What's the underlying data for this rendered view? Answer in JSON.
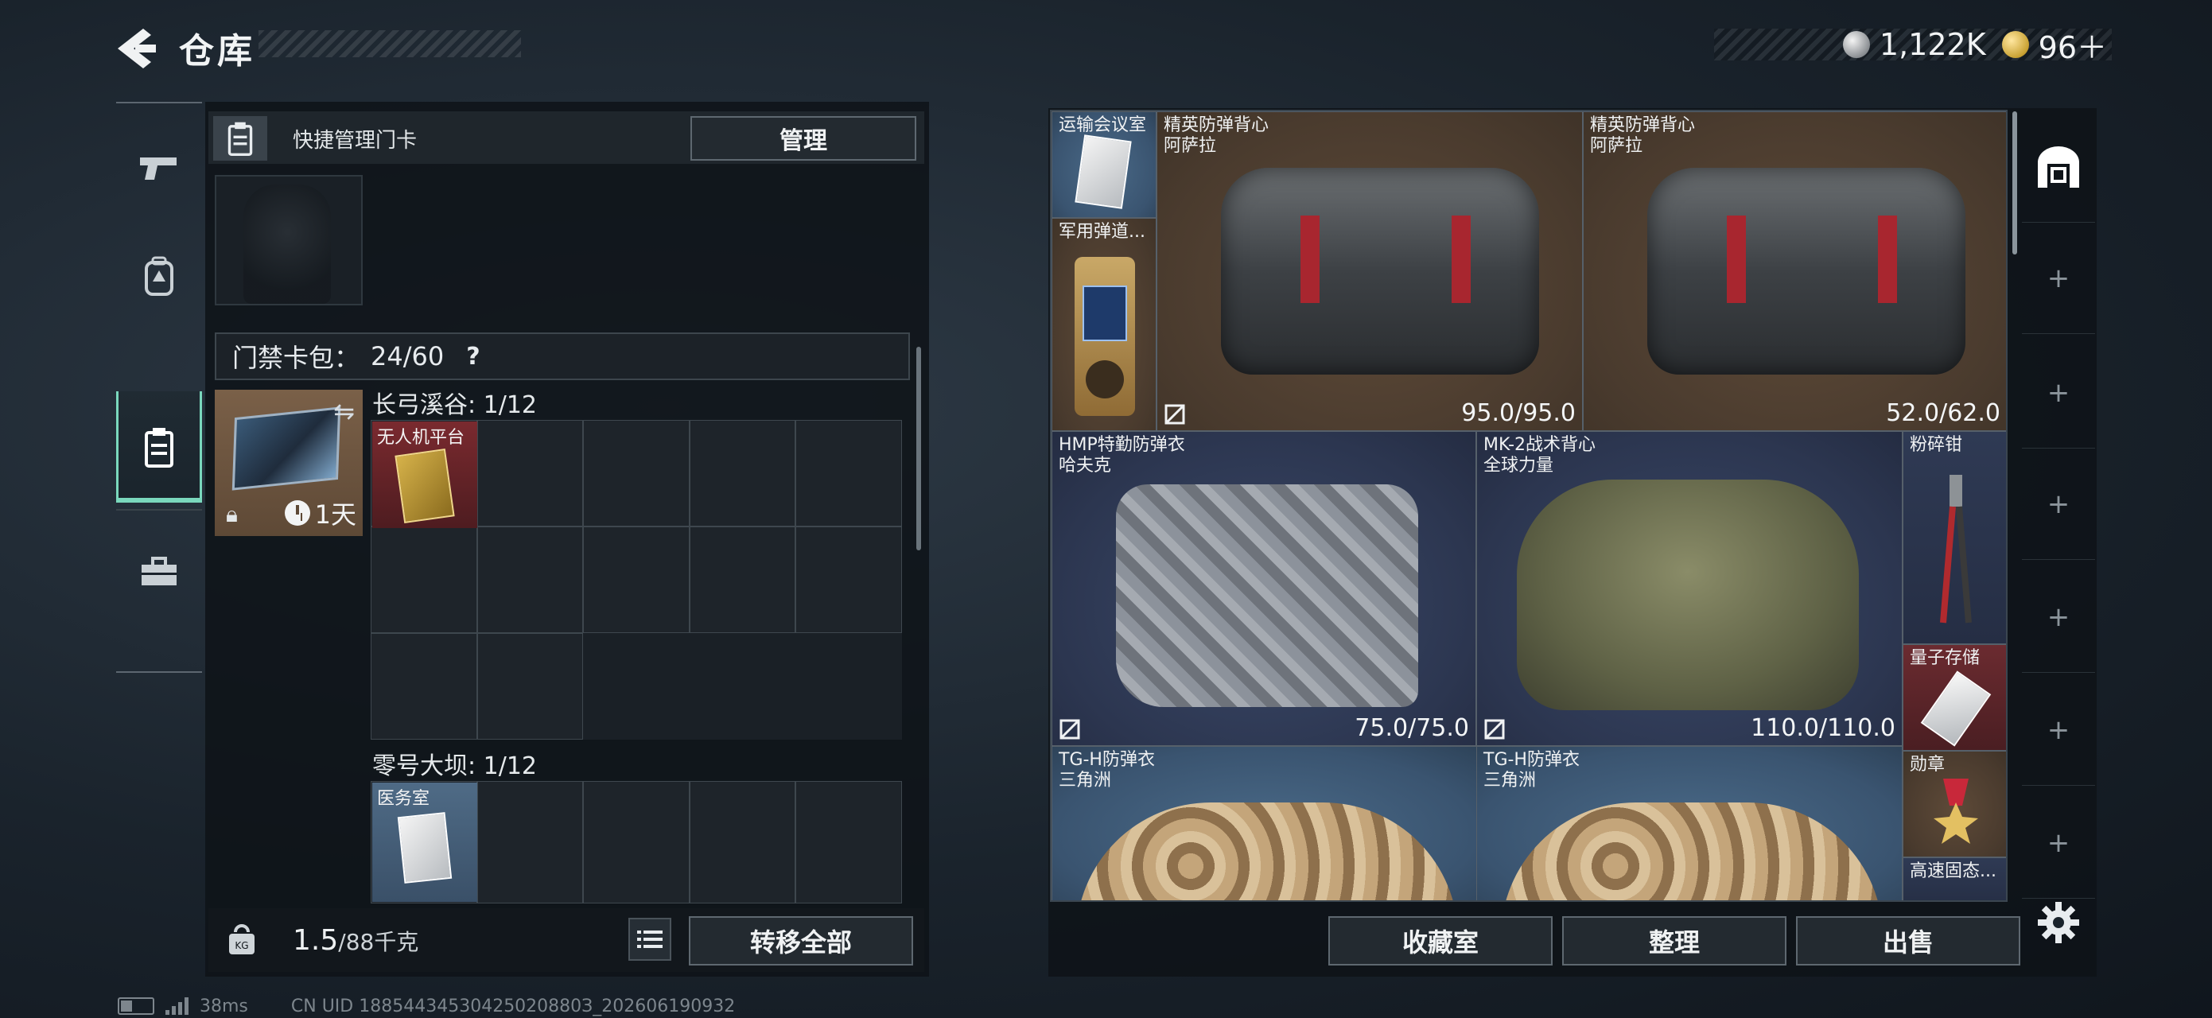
{
  "header": {
    "title": "仓库"
  },
  "currency": {
    "silver": "1,122K",
    "gold": "96＋"
  },
  "left_nav": {
    "items": [
      "weapons",
      "equipment",
      "keycards",
      "toolbox"
    ],
    "active": "keycards"
  },
  "quick_manage": {
    "label": "快捷管理门卡",
    "button": "管理"
  },
  "card_bag": {
    "label": "门禁卡包：",
    "count": "24/60",
    "help": "?"
  },
  "card_item": {
    "timer": "1天"
  },
  "grids": [
    {
      "title": "长弓溪谷: 1/12",
      "card": "无人机平台"
    },
    {
      "title": "零号大坝: 1/12",
      "card": "医务室"
    }
  ],
  "weight": {
    "value": "1.5",
    "capacity": "/88千克"
  },
  "transfer_all": "转移全部",
  "stash": {
    "items": [
      {
        "name": "运输会议室"
      },
      {
        "name": "军用弹道..."
      },
      {
        "name": "精英防弹背心",
        "sub": "阿萨拉",
        "durability": "95.0/95.0"
      },
      {
        "name": "精英防弹背心",
        "sub": "阿萨拉",
        "durability": "52.0/62.0"
      },
      {
        "name": "HMP特勤防弹衣",
        "sub": "哈夫克",
        "durability": "75.0/75.0"
      },
      {
        "name": "MK-2战术背心",
        "sub": "全球力量",
        "durability": "110.0/110.0"
      },
      {
        "name": "粉碎钳"
      },
      {
        "name": "量子存储"
      },
      {
        "name": "TG-H防弹衣",
        "sub": "三角洲"
      },
      {
        "name": "TG-H防弹衣",
        "sub": "三角洲"
      },
      {
        "name": "勋章"
      },
      {
        "name": "高速固态..."
      }
    ]
  },
  "bottom_buttons": {
    "collection": "收藏室",
    "sort": "整理",
    "sell": "出售"
  },
  "side_tabs": [
    "+",
    "+",
    "+",
    "+",
    "+",
    "+"
  ],
  "status": {
    "ping": "38ms",
    "uid": "CN UID 18854434530425020880З_202606190932"
  },
  "colors": {
    "accent": "#7ad8bd",
    "brown_item": "#4a3b2e",
    "navy_item": "#2c3650",
    "red_item": "#6b2b30"
  }
}
